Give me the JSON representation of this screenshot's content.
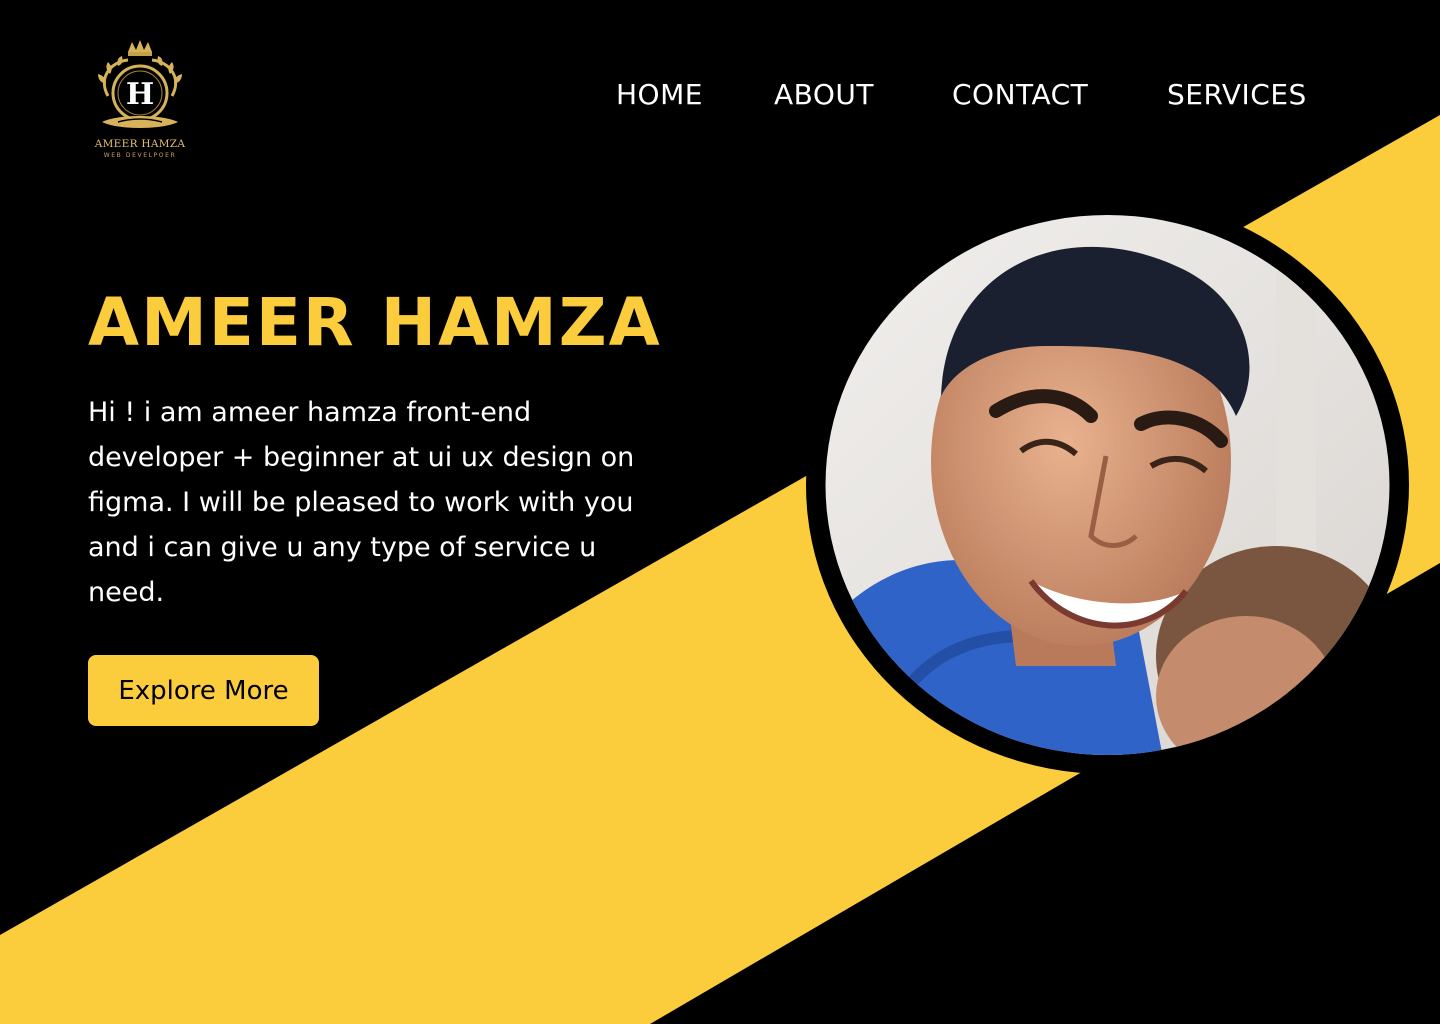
{
  "brand": {
    "logo_letter": "H",
    "logo_name": "AMEER HAMZA",
    "logo_subtitle": "WEB DEVELPOER",
    "gold": "#d6b25a"
  },
  "nav": {
    "items": [
      {
        "label": "HOME"
      },
      {
        "label": "ABOUT"
      },
      {
        "label": "CONTACT"
      },
      {
        "label": "SERVICES"
      }
    ]
  },
  "hero": {
    "title": "AMEER HAMZA",
    "description": "Hi ! i am ameer hamza front-end\ndeveloper + beginner at ui ux design on\nfigma. I will be pleased to work  with you\nand i can give u any type of service u\nneed.",
    "cta_label": "Explore More"
  },
  "portrait": {
    "icon": "profile-photo"
  },
  "colors": {
    "background": "#000000",
    "accent": "#fbcd3c",
    "text": "#ffffff"
  }
}
